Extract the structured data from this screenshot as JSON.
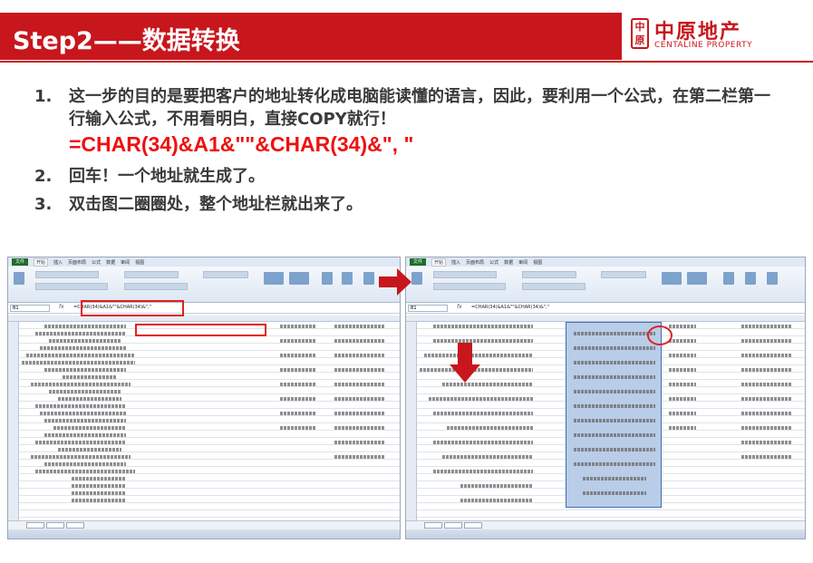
{
  "header": {
    "title": "Step2——数据转换",
    "logo_mark": "中原",
    "logo_cn": "中原地产",
    "logo_en": "CENTALINE PROPERTY"
  },
  "steps": [
    {
      "num": "1.",
      "text": "这一步的目的是要把客户的地址转化成电脑能读懂的语言，因此，要利用一个公式，在第二栏第一行输入公式，不用看明白，直接COPY就行！"
    },
    {
      "num": "2.",
      "text": "回车！一个地址就生成了。"
    },
    {
      "num": "3.",
      "text": "双击图二圈圈处，整个地址栏就出来了。"
    }
  ],
  "formula": "=CHAR(34)&A1&\"\"&CHAR(34)&\", \"",
  "screenshots": [
    {
      "file_tab": "文件",
      "tabs": [
        "开始",
        "插入",
        "页面布局",
        "公式",
        "数据",
        "审阅",
        "视图"
      ],
      "namebox": "B1",
      "formula_text": "=CHAR(34)&A1&\"\"&CHAR(34)&\",\""
    },
    {
      "file_tab": "文件",
      "tabs": [
        "开始",
        "插入",
        "页面布局",
        "公式",
        "数据",
        "审阅",
        "视图"
      ],
      "namebox": "B1",
      "formula_text": "=CHAR(34)&A1&\"\"&CHAR(34)&\",\""
    }
  ],
  "colors": {
    "brand_red": "#c8161d",
    "formula_red": "#ee1111",
    "text_gray": "#3a3a3a"
  }
}
